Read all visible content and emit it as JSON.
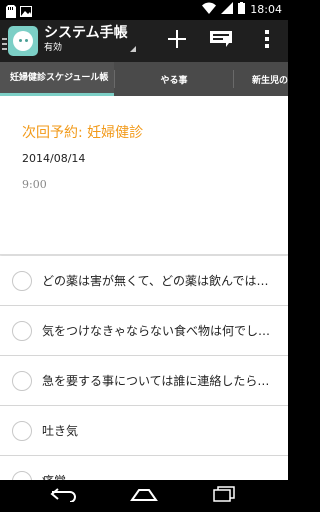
{
  "status_bar": {
    "time": "18:04"
  },
  "action_bar": {
    "title": "システム手帳",
    "subtitle": "有効"
  },
  "tabs": [
    {
      "label": "妊婦健診スケジュール帳",
      "active": true
    },
    {
      "label": "やる事",
      "active": false
    },
    {
      "label": "新生児の",
      "active": false
    }
  ],
  "appointment": {
    "title": "次回予約: 妊婦健診",
    "date": "2014/08/14",
    "time": "9:00"
  },
  "todo_items": [
    "どの薬は害が無くて、どの薬は飲んでは…",
    "気をつけなきゃならない食べ物は何でし…",
    "急を要する事については誰に連絡したら…",
    "吐き気",
    "痛覚"
  ],
  "colors": {
    "accent": "#7ccfc6",
    "appointment_title": "#f29a1a",
    "tab_bar": "#4a4a4a",
    "action_bar": "#1f1f1f"
  },
  "icons": [
    "sd-card-icon",
    "image-icon",
    "wifi-icon",
    "signal-icon",
    "battery-icon",
    "add-icon",
    "label-icon",
    "overflow-menu-icon",
    "back-icon",
    "home-icon",
    "recent-apps-icon"
  ]
}
